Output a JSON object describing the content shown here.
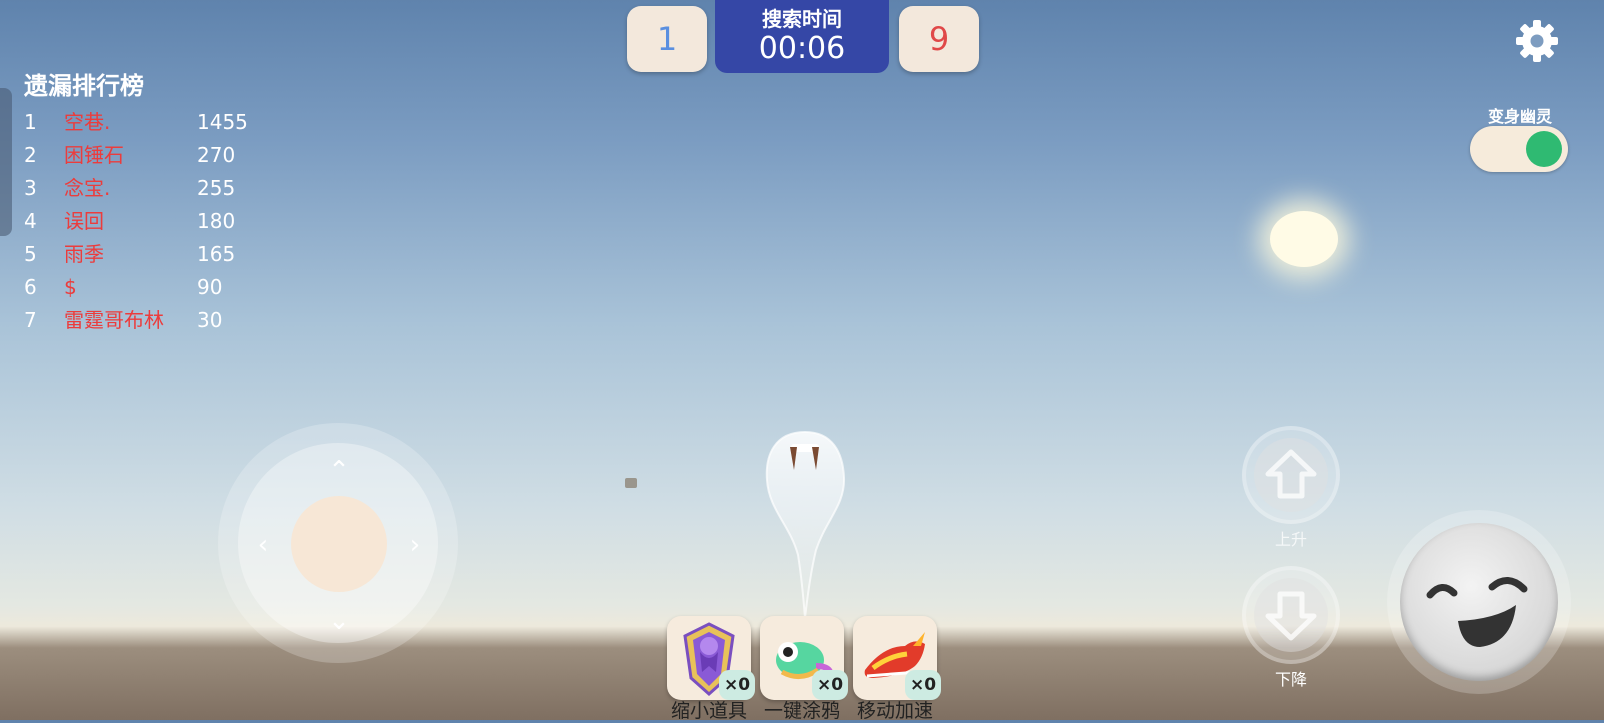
{
  "scores": {
    "left": "1",
    "left_color": "#5a8fe0",
    "right": "9",
    "right_color": "#e04848"
  },
  "timer": {
    "label": "搜索时间",
    "value": "00:06"
  },
  "leaderboard": {
    "title": "遗漏排行榜",
    "rows": [
      {
        "rank": "1",
        "name": "空巷.",
        "score": "1455"
      },
      {
        "rank": "2",
        "name": "困锤石",
        "score": "270"
      },
      {
        "rank": "3",
        "name": "念宝.",
        "score": "255"
      },
      {
        "rank": "4",
        "name": "误回",
        "score": "180"
      },
      {
        "rank": "5",
        "name": "雨季",
        "score": "165"
      },
      {
        "rank": "6",
        "name": "$",
        "score": "90"
      },
      {
        "rank": "7",
        "name": "雷霆哥布林",
        "score": "30"
      }
    ]
  },
  "settings": {
    "icon": "gear-icon"
  },
  "ghost_toggle": {
    "label": "变身幽灵",
    "on": true,
    "on_color": "#2fba72"
  },
  "controls": {
    "up_label": "上升",
    "down_label": "下降",
    "joystick_arrows": {
      "up": "⌃",
      "down": "⌄",
      "left": "‹",
      "right": "›"
    }
  },
  "items": [
    {
      "label": "缩小道具",
      "count": "×0",
      "icon": "octopus-shield-icon"
    },
    {
      "label": "一键涂鸦",
      "count": "×0",
      "icon": "chameleon-icon"
    },
    {
      "label": "移动加速",
      "count": "×0",
      "icon": "flame-sneaker-icon"
    }
  ]
}
